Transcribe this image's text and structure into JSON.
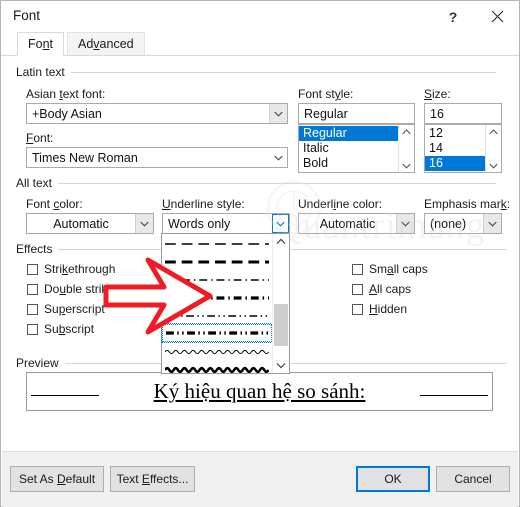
{
  "window": {
    "title": "Font",
    "help_icon": "question-mark-icon",
    "close_icon": "close-icon"
  },
  "tabs": [
    {
      "label": "Font",
      "active": true
    },
    {
      "label": "Advanced",
      "active": false
    }
  ],
  "groups": {
    "latin_text": "Latin text",
    "all_text": "All text",
    "effects": "Effects",
    "preview": "Preview"
  },
  "latin_text": {
    "asian_font_label": "Asian text font:",
    "asian_font_value": "+Body Asian",
    "font_label": "Font:",
    "font_value": "Times New Roman",
    "font_style_label": "Font style:",
    "font_style_value": "Regular",
    "font_style_options": [
      "Regular",
      "Italic",
      "Bold"
    ],
    "font_style_selected": "Regular",
    "size_label": "Size:",
    "size_value": "16",
    "size_options": [
      "12",
      "14",
      "16"
    ],
    "size_selected": "16"
  },
  "all_text": {
    "font_color_label": "Font color:",
    "font_color_value": "Automatic",
    "underline_style_label": "Underline style:",
    "underline_style_value": "Words only",
    "underline_color_label": "Underline color:",
    "underline_color_value": "Automatic",
    "emphasis_mark_label": "Emphasis mark:",
    "emphasis_mark_value": "(none)"
  },
  "underline_dropdown": {
    "open": true,
    "options": [
      {
        "name": "dash-thin",
        "style": "dash",
        "weight": 1,
        "focused": false
      },
      {
        "name": "dash-thick",
        "style": "dash",
        "weight": 2,
        "focused": false
      },
      {
        "name": "dash-dot-thin",
        "style": "dashdot",
        "weight": 1,
        "focused": false
      },
      {
        "name": "dash-dot-thick",
        "style": "dashdot",
        "weight": 2,
        "focused": false
      },
      {
        "name": "dash-dot-dot-thin",
        "style": "dashdotdot",
        "weight": 1,
        "focused": false
      },
      {
        "name": "dash-dot-dot-thick",
        "style": "dashdotdot",
        "weight": 2,
        "focused": true
      },
      {
        "name": "wave-thin",
        "style": "wave",
        "weight": 1,
        "focused": false
      },
      {
        "name": "wave-thick",
        "style": "wave",
        "weight": 2,
        "focused": false
      }
    ],
    "scroll_up_icon": "chevron-up-icon",
    "scroll_down_icon": "chevron-down-icon"
  },
  "effects": {
    "left": [
      {
        "label": "Strikethrough",
        "checked": false
      },
      {
        "label": "Double strikethrough",
        "checked": false
      },
      {
        "label": "Superscript",
        "checked": false
      },
      {
        "label": "Subscript",
        "checked": false
      }
    ],
    "right": [
      {
        "label": "Small caps",
        "checked": false
      },
      {
        "label": "All caps",
        "checked": false
      },
      {
        "label": "Hidden",
        "checked": false
      }
    ]
  },
  "preview": {
    "text": "Ký hiệu quan hệ so sánh:"
  },
  "footer": {
    "set_as_default": "Set As Default",
    "text_effects": "Text Effects...",
    "ok": "OK",
    "cancel": "Cancel"
  },
  "annotation": {
    "arrow_color": "#ee1c25",
    "arrow_name": "red-pointer-arrow"
  },
  "watermark": {
    "text": "Quantrimang"
  },
  "colors": {
    "accent": "#0078d7",
    "dialog_bg": "#ffffff",
    "footer_bg": "#f0f0f0",
    "selection": "#0078d7"
  }
}
